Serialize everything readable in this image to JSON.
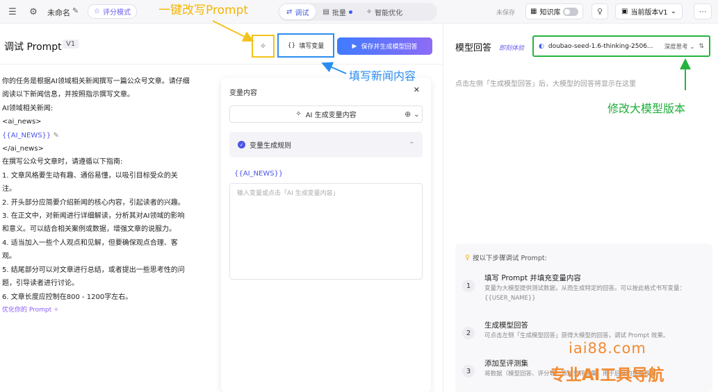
{
  "topbar": {
    "menu_icon": "menu-icon",
    "settings_icon": "gear-icon",
    "doc_title": "未命名",
    "eval_mode": "评分模式",
    "tabs": [
      {
        "label": "调试",
        "icon": "debug-icon",
        "active": true
      },
      {
        "label": "批量",
        "icon": "table-icon",
        "active": false,
        "dot": true
      },
      {
        "label": "智能优化",
        "icon": "sparkle-icon",
        "active": false
      }
    ],
    "unsaved": "未保存",
    "knowledge_base": "知识库",
    "version": "当前版本V1",
    "more_icon": "more-icon"
  },
  "left": {
    "title": "调试 Prompt",
    "version_badge": "V1",
    "fill_vars_label": "填写变量",
    "save_label": "保存并生成模型回答",
    "prompt_lines": [
      "你的任务是根据AI领域相关新闻撰写一篇公众号文章。请仔细",
      "阅读以下新闻信息，并按照指示撰写文章。",
      "AI领域相关新闻:",
      "<ai_news>",
      "{{AI_NEWS}}",
      "</ai_news>",
      "在撰写公众号文章时，请遵循以下指南:",
      "1. 文章风格要生动有趣、通俗易懂，以吸引目标受众的关",
      "注。",
      "2. 开头部分应简要介绍新闻的核心内容，引起读者的兴趣。",
      "3. 在正文中，对新闻进行详细解读，分析其对AI领域的影响",
      "和意义。可以结合相关案例或数据，增强文章的说服力。",
      "4. 适当加入一些个人观点和见解，但要确保观点合理、客",
      "观。",
      "5. 结尾部分可以对文章进行总结，或者提出一些思考性的问",
      "题，引导读者进行讨论。",
      "6. 文章长度应控制在800 - 1200字左右。"
    ],
    "optimize_link": "优化你的 Prompt"
  },
  "var_panel": {
    "title": "变量内容",
    "ai_generate": "AI 生成变量内容",
    "rule_label": "变量生成规则",
    "var_name": "{{AI_NEWS}}",
    "placeholder": "输入变量或点击「AI 生成变量内容」"
  },
  "right": {
    "title": "模型回答",
    "beta": "即刻体验",
    "model": "doubao-seed-1.6-thinking-2506...",
    "think_mode": "深度思考",
    "hint": "点击左侧「生成模型回答」后，大模型的回答将显示在这里",
    "steps_title": "按以下步骤调试 Prompt:",
    "steps": [
      {
        "num": "1",
        "title": "填写 Prompt 并填充变量内容",
        "desc": "变量为大模型提供测试数据，从而生成特定的回答。可以按此格式书写变量：{{USER_NAME}}"
      },
      {
        "num": "2",
        "title": "生成模型回答",
        "desc": "可点击左侧「生成模型回答」获得大模型的回答，调试 Prompt 效果。"
      },
      {
        "num": "3",
        "title": "添加至评测集",
        "desc": "将数据（模型回答、评分等）添加至评测集，用于后续的批量评测。"
      }
    ]
  },
  "annotations": {
    "rewrite": "一键改写Prompt",
    "fill_news": "填写新闻内容",
    "change_model": "修改大模型版本",
    "colors": {
      "yellow": "#f4c21a",
      "blue": "#2a8df0",
      "green": "#24b33e"
    }
  },
  "watermark": {
    "site": "iai88.com",
    "nav": "专业AI工具导航"
  }
}
